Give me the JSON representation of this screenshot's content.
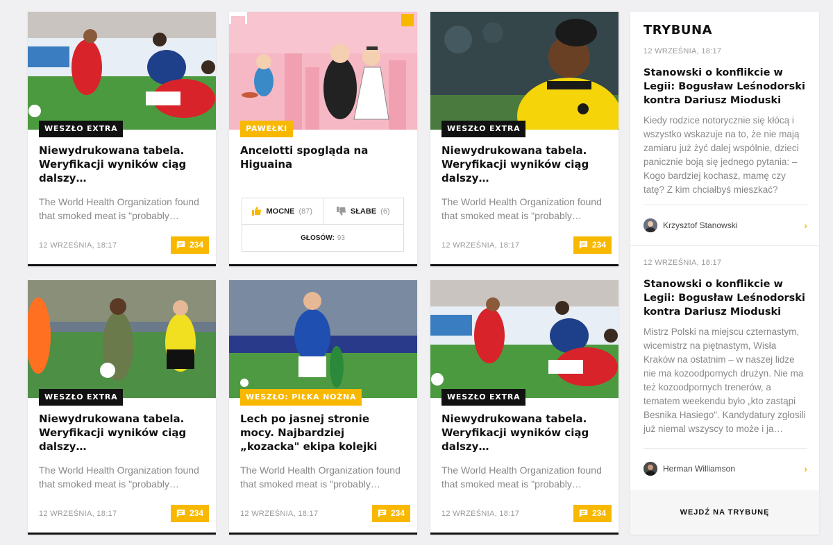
{
  "cards": [
    {
      "tag": "WESZŁO EXTRA",
      "title": "Niewydrukowana tabela. Weryfikacji wyników ciąg dalszy…",
      "excerpt": "The World Health Organization found that smoked meat is \"probably…",
      "date": "12 WRZEŚNIA, 18:17",
      "comments": "234"
    },
    {
      "tag": "PAWEŁKI",
      "title": "Ancelotti spogląda na Higuaina",
      "vote": {
        "strong_label": "MOCNE",
        "strong_count": "(87)",
        "weak_label": "SŁABE",
        "weak_count": "(6)",
        "total_label": "GŁOSÓW:",
        "total_count": "93"
      }
    },
    {
      "tag": "WESZŁO EXTRA",
      "title": "Niewydrukowana tabela. Weryfikacji wyników ciąg dalszy…",
      "excerpt": "The World Health Organization found that smoked meat is \"probably…",
      "date": "12 WRZEŚNIA, 18:17",
      "comments": "234"
    },
    {
      "tag": "WESZŁO EXTRA",
      "title": "Niewydrukowana tabela. Weryfikacji wyników ciąg dalszy…",
      "excerpt": "The World Health Organization found that smoked meat is \"probably…",
      "date": "12 WRZEŚNIA, 18:17",
      "comments": "234"
    },
    {
      "tag": "WESZŁO: PIŁKA NOŻNA",
      "title": "Lech po jasnej stronie mocy. Najbardziej „kozacka\" ekipa kolejki",
      "excerpt": "The World Health Organization found that smoked meat is \"probably…",
      "date": "12 WRZEŚNIA, 18:17",
      "comments": "234"
    },
    {
      "tag": "WESZŁO EXTRA",
      "title": "Niewydrukowana tabela. Weryfikacji wyników ciąg dalszy…",
      "excerpt": "The World Health Organization found that smoked meat is \"probably…",
      "date": "12 WRZEŚNIA, 18:17",
      "comments": "234"
    }
  ],
  "sidebar": {
    "heading": "TRYBUNA",
    "items": [
      {
        "date": "12 WRZEŚNIA, 18:17",
        "title": "Stanowski o konflikcie w Legii: Bogusław Leśnodorski kontra Dariusz Mioduski",
        "text": "Kiedy rodzice notorycznie się kłócą i wszystko wskazuje na to, że nie mają zamiaru już żyć dalej wspólnie, dzieci panicznie boją się jednego pytania: – Kogo bardziej kochasz, mamę czy tatę? Z kim chciałbyś mieszkać?",
        "author": "Krzysztof Stanowski"
      },
      {
        "date": "12 WRZEŚNIA, 18:17",
        "title": "Stanowski o konflikcie w Legii: Bogusław Leśnodorski kontra Dariusz Mioduski",
        "text": "Mistrz Polski na miejscu czternastym, wicemistrz na piętnastym, Wisła Kraków na ostatnim – w naszej lidze nie ma kozoodpornych drużyn. Nie ma też kozoodpornych trenerów, a tematem weekendu było „kto zastąpi Besnika Hasiego\". Kandydatury zgłosili już niemal wszyscy to może i ja…",
        "author": "Herman Williamson"
      }
    ],
    "footer_label": "WEJDŹ NA TRYBUNĘ"
  },
  "colors": {
    "accent": "#f8b800",
    "dark": "#111111",
    "muted": "#888888"
  }
}
